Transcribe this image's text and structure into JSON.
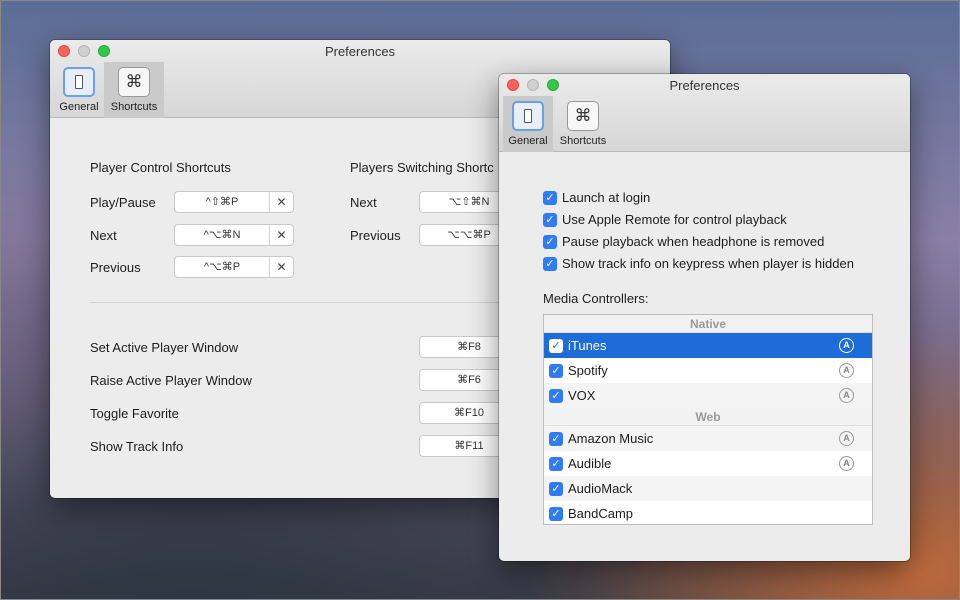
{
  "back_window": {
    "title": "Preferences",
    "tabs": [
      {
        "label": "General"
      },
      {
        "label": "Shortcuts"
      }
    ],
    "player_control": {
      "heading": "Player Control Shortcuts",
      "rows": [
        {
          "label": "Play/Pause",
          "key": "^⇧⌘P",
          "clear": "✕"
        },
        {
          "label": "Next",
          "key": "^⌥⌘N",
          "clear": "✕"
        },
        {
          "label": "Previous",
          "key": "^⌥⌘P",
          "clear": "✕"
        }
      ]
    },
    "players_switching": {
      "heading": "Players Switching Shortc",
      "rows": [
        {
          "label": "Next",
          "key": "⌥⇧⌘N"
        },
        {
          "label": "Previous",
          "key": "⌥⌥⌘P"
        }
      ]
    },
    "global": [
      {
        "label": "Set Active Player Window",
        "key": "⌘F8"
      },
      {
        "label": "Raise Active Player Window",
        "key": "⌘F6"
      },
      {
        "label": "Toggle Favorite",
        "key": "⌘F10"
      },
      {
        "label": "Show Track Info",
        "key": "⌘F11"
      }
    ]
  },
  "front_window": {
    "title": "Preferences",
    "tabs": [
      {
        "label": "General"
      },
      {
        "label": "Shortcuts"
      }
    ],
    "options": [
      {
        "label": "Launch at login",
        "checked": true
      },
      {
        "label": "Use Apple Remote for control playback",
        "checked": true
      },
      {
        "label": "Pause playback when headphone is removed",
        "checked": true
      },
      {
        "label": "Show track info on keypress when player is hidden",
        "checked": true
      }
    ],
    "media_controllers_label": "Media Controllers:",
    "groups": {
      "native": {
        "label": "Native",
        "items": [
          {
            "name": "iTunes",
            "checked": true,
            "selected": true,
            "a_icon": "A"
          },
          {
            "name": "Spotify",
            "checked": true,
            "a_icon": "A"
          },
          {
            "name": "VOX",
            "checked": true,
            "a_icon": "A"
          }
        ]
      },
      "web": {
        "label": "Web",
        "items": [
          {
            "name": "Amazon Music",
            "checked": true,
            "a_icon": "A"
          },
          {
            "name": "Audible",
            "checked": true,
            "a_icon": "A"
          },
          {
            "name": "AudioMack",
            "checked": true
          },
          {
            "name": "BandCamp",
            "checked": true
          }
        ]
      }
    }
  },
  "check_glyph": "✓",
  "colors": {
    "accent": "#1e6cd8",
    "checkbox": "#2f7cf6"
  }
}
